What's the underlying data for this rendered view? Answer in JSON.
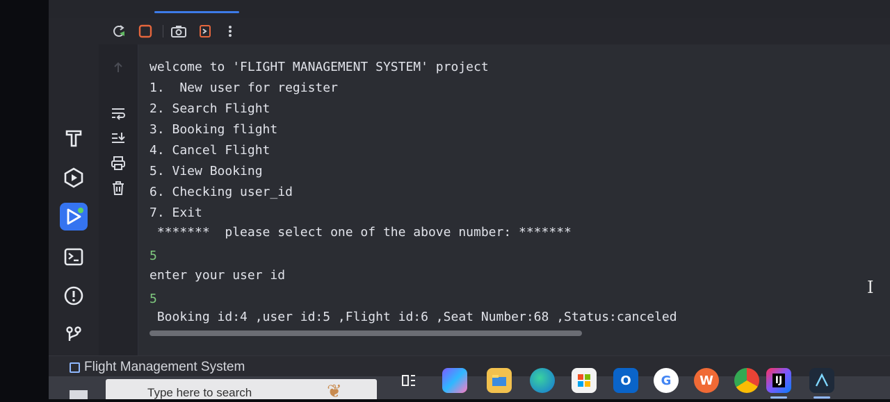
{
  "toolbar": {
    "rerun": "rerun-icon",
    "stop": "stop-icon",
    "screenshot": "camera-icon",
    "exit_ide": "exit-icon",
    "more": "more-vertical-icon"
  },
  "tool_window_bar": {
    "items": [
      "build-hammer-icon",
      "services-icon",
      "run-icon",
      "terminal-icon",
      "problems-icon",
      "version-control-icon"
    ],
    "active_item": "run-icon",
    "accent_color": "#3574f0"
  },
  "console_actions": [
    "soft-wrap-icon",
    "scroll-to-end-icon",
    "print-icon",
    "clear-all-icon"
  ],
  "console": {
    "lines": [
      "welcome to 'FLIGHT MANAGEMENT SYSTEM' project",
      "1.  New user for register",
      "2. Search Flight",
      "3. Booking flight",
      "4. Cancel Flight",
      "5. View Booking",
      "6. Checking user_id",
      "7. Exit",
      " *******  please select one of the above number: *******",
      "5",
      "enter your user id",
      "5",
      " Booking id:4 ,user id:5 ,Flight id:6 ,Seat Number:68 ,Status:canceled"
    ],
    "input_color": "#7fc97f",
    "text_color": "#e1e3ea"
  },
  "status_bar": {
    "project_name": "Flight Management System"
  },
  "taskbar": {
    "search_placeholder": "Type here to search",
    "apps": [
      "task-view-icon",
      "copilot-icon",
      "file-explorer-icon",
      "edge-icon",
      "store-icon",
      "outlook-icon",
      "google-chrome-icon",
      "wps-office-icon",
      "chrome-profile-icon",
      "intellij-idea-icon",
      "android-studio-icon"
    ]
  }
}
